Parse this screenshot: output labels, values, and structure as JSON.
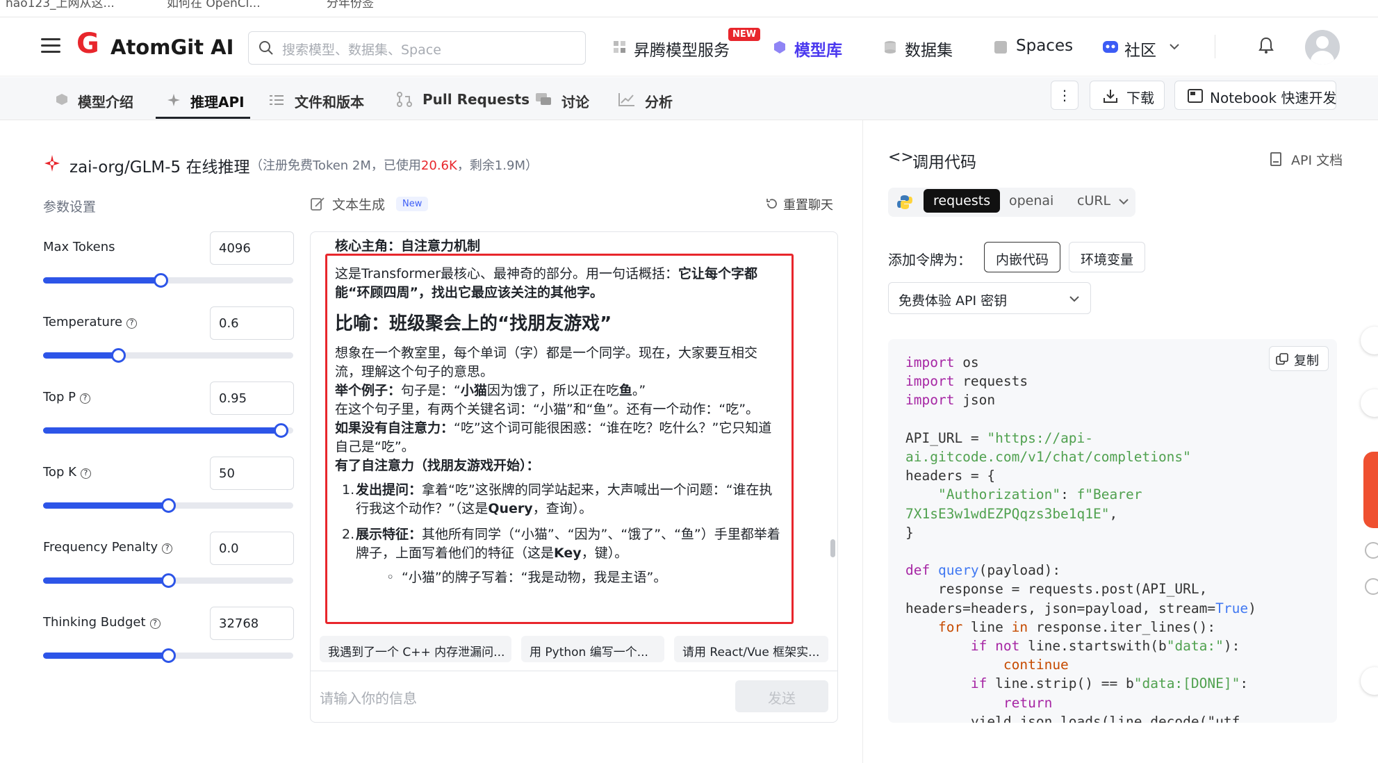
{
  "browser_bar": {
    "bookmark1": "hao123_上网从这...",
    "bookmark2": "如何在 OpenCl...",
    "bookmark3": "分年份签"
  },
  "nav": {
    "brand": "AtomGit AI",
    "search_placeholder": "搜索模型、数据集、Space",
    "items": [
      {
        "label": "昇腾模型服务",
        "badge": "NEW"
      },
      {
        "label": "模型库"
      },
      {
        "label": "数据集"
      },
      {
        "label": "Spaces"
      },
      {
        "label": "社区"
      }
    ]
  },
  "subnav": {
    "tabs": [
      "模型介绍",
      "推理API",
      "文件和版本",
      "Pull Requests",
      "讨论",
      "分析"
    ],
    "active_tab": "推理API",
    "more_label": "⋮",
    "download_label": "下载",
    "notebook_label": "Notebook 快速开发"
  },
  "model": {
    "name": "zai-org/GLM-5 在线推理",
    "quota_prefix": "（注册免费Token 2M，已使用",
    "quota_used": "20.6K",
    "quota_suffix": "，剩余1.9M）"
  },
  "params": {
    "title": "参数设置",
    "items": [
      {
        "label": "Max Tokens",
        "value": "4096",
        "level": 0.47,
        "help": false
      },
      {
        "label": "Temperature",
        "value": "0.6",
        "level": 0.3,
        "help": true
      },
      {
        "label": "Top P",
        "value": "0.95",
        "level": 0.95,
        "help": true
      },
      {
        "label": "Top K",
        "value": "50",
        "level": 0.5,
        "help": true
      },
      {
        "label": "Frequency Penalty",
        "value": "0.0",
        "level": 0.5,
        "help": true
      },
      {
        "label": "Thinking Budget",
        "value": "32768",
        "level": 0.5,
        "help": true
      }
    ]
  },
  "chat": {
    "mode_label": "文本生成",
    "mode_badge": "New",
    "reset_label": "重置聊天",
    "heading_partial": "核心主角：自注意力机制",
    "p1_a": "这是Transformer最核心、最神奇的部分。用一句话概括：",
    "p1_b": "它让每个字都能“环顾四周”，找出它最应该关注的其他字。",
    "h2": "比喻：班级聚会上的“找朋友游戏”",
    "p2": "想象在一个教室里，每个单词（字）都是一个同学。现在，大家要互相交流，理解这个句子的意思。",
    "ex_label": "举个例子：",
    "ex_a": "句子是：“",
    "ex_b": "小猫",
    "ex_c": "因为饿了，所以正在吃",
    "ex_d": "鱼",
    "ex_e": "。”",
    "p3": "在这个句子里，有两个关键名词：“小猫”和“鱼”。还有一个动作：“吃”。",
    "no_attn_label": "如果没有自注意力：",
    "no_attn_text": "“吃”这个词可能很困惑：“谁在吃？吃什么？”它只知道自己是“吃”。",
    "with_attn": "有了自注意力（找朋友游戏开始）：",
    "step1_label": "发出提问：",
    "step1_a": "拿着“吃”这张牌的同学站起来，大声喊出一个问题：“谁在执行我这个动作？”（这是",
    "step1_b": "Query",
    "step1_c": "，查询）。",
    "step2_label": "展示特征：",
    "step2_a": "其他所有同学（“小猫”、“因为”、“饿了”、“鱼”）手里都举着牌子，上面写着他们的特征（这是",
    "step2_b": "Key",
    "step2_c": "，键）。",
    "bullet1": "“小猫”的牌子写着：“我是动物，我是主语”。",
    "suggestions": [
      "我遇到了一个 C++ 内存泄漏问...",
      "用 Python 编写一个...",
      "请用 React/Vue 框架实..."
    ],
    "input_placeholder": "请输入你的信息",
    "send_label": "发送"
  },
  "code_panel": {
    "title": "调用代码",
    "api_doc": "API 文档",
    "lang_tabs": [
      "requests",
      "openai",
      "cURL"
    ],
    "active_lang": "requests",
    "token_label": "添加令牌为：",
    "token_opts": [
      "内嵌代码",
      "环境变量"
    ],
    "active_token_opt": "内嵌代码",
    "key_select": "免费体验 API 密钥",
    "copy_label": "复制",
    "code": {
      "l1": "import os",
      "l2": "import requests",
      "l3": "import json",
      "api_url_a": "API_URL = ",
      "api_url_b": "\"https://api-",
      "api_url_c": "ai.gitcode.com/v1/chat/completions\"",
      "headers": "headers = {",
      "auth_key": "\"Authorization\"",
      "auth_mid": ": ",
      "auth_val_a": "f\"Bearer",
      "auth_val_b": "7X1sE3w1wdEZPQqzs3be1q1E\"",
      "close": "}",
      "def_kw": "def ",
      "def_fn": "query",
      "def_rest": "(payload):",
      "resp": "    response = requests.post(API_URL,",
      "resp2_a": "headers=headers, json=payload, stream=",
      "resp2_b": "True",
      "resp2_c": ")",
      "for_a": "    for ",
      "for_b": "line ",
      "for_c": "in ",
      "for_d": "response.iter_lines():",
      "if1_a": "        if not ",
      "if1_b": "line.startswith(b",
      "if1_c": "\"data:\"",
      "if1_d": "):",
      "cont": "            continue",
      "if2_a": "        if ",
      "if2_b": "line.strip() == b",
      "if2_c": "\"data:[DONE]\"",
      "if2_d": ":",
      "ret": "            return",
      "cut": "        yield json.loads(line.decode(\"utf"
    }
  }
}
